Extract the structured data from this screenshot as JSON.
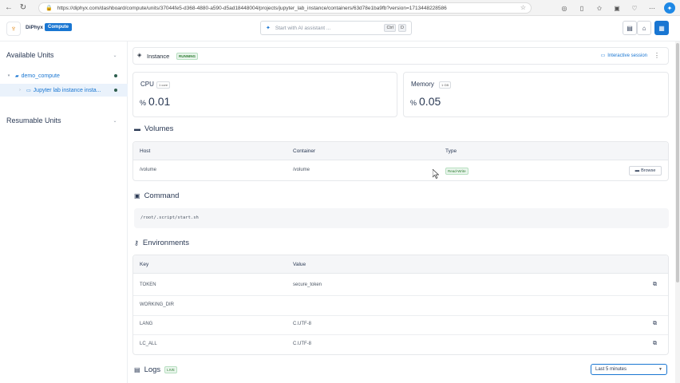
{
  "browser": {
    "url": "https://diphyx.com/dashboard/compute/units/37044fe5-d368-4880-a590-d5ad18448004/projects/jupyter_lab_instance/containers/63d78e1ba9fb?version=1713448228586"
  },
  "header": {
    "brand": "DiPhyx",
    "badge": "Compute",
    "search_placeholder": "Start with AI assistant ...",
    "shortcut_ctrl": "Ctrl",
    "shortcut_key": "D"
  },
  "sidebar": {
    "available_title": "Available Units",
    "resumable_title": "Resumable Units",
    "items": [
      {
        "label": "demo_compute"
      },
      {
        "label": "Jupyter lab instance insta..."
      }
    ]
  },
  "instance": {
    "title": "Instance",
    "status": "RUNNING",
    "interactive_label": "Interactive session"
  },
  "metrics": {
    "cpu": {
      "label": "CPU",
      "badge": "1 core",
      "unit": "%",
      "value": "0.01"
    },
    "memory": {
      "label": "Memory",
      "badge": "1 GB",
      "unit": "%",
      "value": "0.05"
    }
  },
  "volumes": {
    "title": "Volumes",
    "columns": [
      "Host",
      "Container",
      "Type"
    ],
    "rows": [
      {
        "host": "/volume",
        "container": "/volume",
        "type": "Read-Write",
        "action": "Browse"
      }
    ]
  },
  "command": {
    "title": "Command",
    "text": "/root/.script/start.sh"
  },
  "environments": {
    "title": "Environments",
    "columns": [
      "Key",
      "Value"
    ],
    "rows": [
      {
        "key": "TOKEN",
        "value": "secure_token"
      },
      {
        "key": "WORKING_DIR",
        "value": ""
      },
      {
        "key": "LANG",
        "value": "C.UTF-8"
      },
      {
        "key": "LC_ALL",
        "value": "C.UTF-8"
      }
    ]
  },
  "logs": {
    "title": "Logs",
    "badge": "LIVE",
    "range": "Last 5 minutes"
  },
  "colors": {
    "accent": "#1976d2",
    "success": "#2e7d32",
    "brand_orange": "#e38b1c"
  }
}
